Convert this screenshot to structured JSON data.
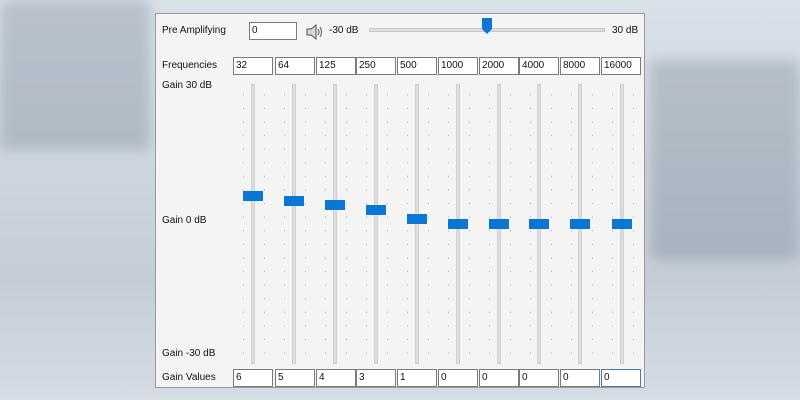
{
  "preamp": {
    "label": "Pre Amplifying",
    "value": "0",
    "min_label": "-30 dB",
    "max_label": "30 dB",
    "min": -30,
    "max": 30,
    "level": 0
  },
  "frequencies": {
    "label": "Frequencies",
    "values": [
      "32",
      "64",
      "125",
      "250",
      "500",
      "1000",
      "2000",
      "4000",
      "8000",
      "16000"
    ]
  },
  "gain_axis": {
    "top": "Gain 30 dB",
    "mid": "Gain 0 dB",
    "bottom": "Gain -30 dB"
  },
  "gain_values": {
    "label": "Gain Values",
    "values": [
      "6",
      "5",
      "4",
      "3",
      "1",
      "0",
      "0",
      "0",
      "0",
      "0"
    ]
  },
  "icons": {
    "speaker": "speaker-icon"
  },
  "colors": {
    "accent": "#0a76d6",
    "panel": "#f4f4f4"
  }
}
